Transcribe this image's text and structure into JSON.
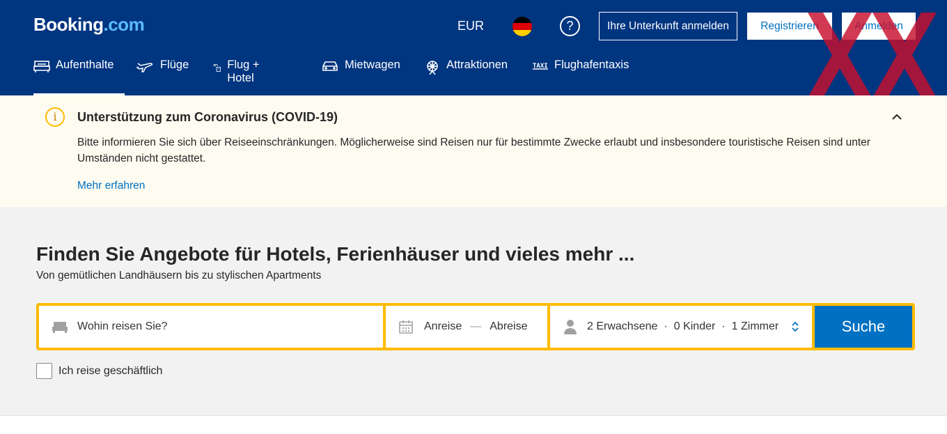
{
  "header": {
    "logo_main": "Booking",
    "logo_dot": ".com",
    "currency": "EUR",
    "help": "?",
    "list_property": "Ihre Unterkunft anmelden",
    "register": "Registrieren",
    "login": "Anmelden"
  },
  "nav": {
    "items": [
      {
        "label": "Aufenthalte",
        "icon": "bed-icon",
        "active": true
      },
      {
        "label": "Flüge",
        "icon": "plane-icon"
      },
      {
        "label": "Flug + Hotel",
        "icon": "flight-hotel-icon"
      },
      {
        "label": "Mietwagen",
        "icon": "car-icon"
      },
      {
        "label": "Attraktionen",
        "icon": "attractions-icon"
      },
      {
        "label": "Flughafentaxis",
        "icon": "taxi-icon"
      }
    ],
    "taxi_badge": "TAXI"
  },
  "banner": {
    "title": "Unterstützung zum Coronavirus (COVID-19)",
    "text": "Bitte informieren Sie sich über Reiseeinschränkungen. Möglicherweise sind Reisen nur für bestimmte Zwecke erlaubt und insbesondere touristische Reisen sind unter Umständen nicht gestattet.",
    "link": "Mehr erfahren",
    "info": "i"
  },
  "search": {
    "headline": "Finden Sie Angebote für Hotels, Ferienhäuser und vieles mehr ...",
    "subline": "Von gemütlichen Landhäusern bis zu stylischen Apartments",
    "destination_placeholder": "Wohin reisen Sie?",
    "checkin": "Anreise",
    "date_separator": "—",
    "checkout": "Abreise",
    "adults": "2 Erwachsene",
    "children": "0 Kinder",
    "rooms": "1 Zimmer",
    "separator": "·",
    "button": "Suche",
    "business_label": "Ich reise geschäftlich"
  },
  "colors": {
    "brand_blue": "#003580",
    "accent_yellow": "#febb02",
    "link_blue": "#0071c2"
  }
}
